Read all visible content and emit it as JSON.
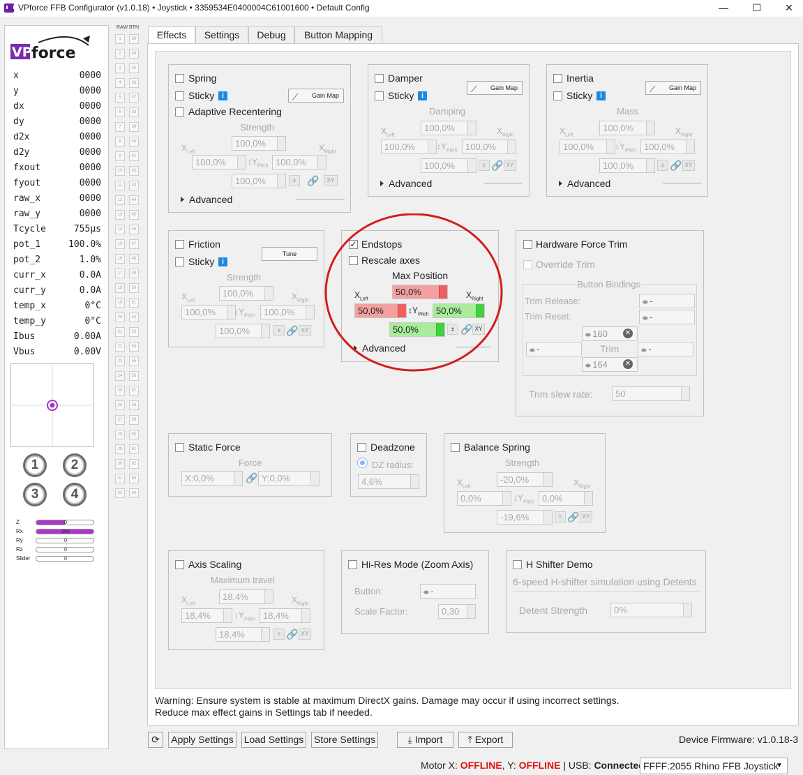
{
  "window": {
    "title": "VPforce FFB Configurator (v1.0.18) • Joystick • 3359534E0400004C61001600 • Default Config",
    "min": "—",
    "max": "☐",
    "close": "✕"
  },
  "telemetry": [
    {
      "k": "x",
      "v": "0000"
    },
    {
      "k": "y",
      "v": "0000"
    },
    {
      "k": "dx",
      "v": "0000"
    },
    {
      "k": "dy",
      "v": "0000"
    },
    {
      "k": "d2x",
      "v": "0000"
    },
    {
      "k": "d2y",
      "v": "0000"
    },
    {
      "k": "fxout",
      "v": "0000"
    },
    {
      "k": "fyout",
      "v": "0000"
    },
    {
      "k": "raw_x",
      "v": "0000"
    },
    {
      "k": "raw_y",
      "v": "0000"
    },
    {
      "k": "Tcycle",
      "v": "755µs"
    },
    {
      "k": "pot_1",
      "v": "100.0%"
    },
    {
      "k": "pot_2",
      "v": "1.0%"
    },
    {
      "k": "curr_x",
      "v": "0.0A"
    },
    {
      "k": "curr_y",
      "v": "0.0A"
    },
    {
      "k": "temp_x",
      "v": "0°C"
    },
    {
      "k": "temp_y",
      "v": "0°C"
    },
    {
      "k": "Ibus",
      "v": "0.00A"
    },
    {
      "k": "Vbus",
      "v": "0.00V"
    }
  ],
  "pov_buttons": [
    "1",
    "2",
    "3",
    "4"
  ],
  "axes": [
    {
      "label": "Z",
      "value": "0",
      "fill": 0.5
    },
    {
      "label": "Rx",
      "value": "255",
      "fill": 1.0
    },
    {
      "label": "Ry",
      "value": "0",
      "fill": 0
    },
    {
      "label": "Rz",
      "value": "0",
      "fill": 0
    },
    {
      "label": "Slider",
      "value": "0",
      "fill": 0
    }
  ],
  "raw_btn": {
    "header": "RAW BTN",
    "left": [
      "1",
      "2",
      "3",
      "4",
      "5",
      "6",
      "7",
      "8",
      "9",
      "10",
      "11",
      "12",
      "13",
      "14",
      "15",
      "16",
      "17",
      "18",
      "19",
      "20",
      "21",
      "22",
      "23",
      "24",
      "25",
      "26",
      "27",
      "28",
      "29",
      "30",
      "31",
      "32"
    ],
    "right": [
      "33",
      "34",
      "35",
      "36",
      "37",
      "38",
      "39",
      "40",
      "41",
      "42",
      "43",
      "44",
      "45",
      "46",
      "47",
      "48",
      "49",
      "50",
      "51",
      "52",
      "53",
      "54",
      "55",
      "56",
      "57",
      "58",
      "59",
      "60",
      "61",
      "62",
      "63",
      "64"
    ]
  },
  "tabs": [
    "Effects",
    "Settings",
    "Debug",
    "Button Mapping"
  ],
  "spring": {
    "title": "Spring",
    "sticky": "Sticky",
    "adaptive": "Adaptive Recentering",
    "gain_map": "Gain Map",
    "strength": "Strength",
    "top": "100,0%",
    "left": "100,0%",
    "right": "100,0%",
    "bottom": "100,0%",
    "advanced": "Advanced"
  },
  "damper": {
    "title": "Damper",
    "sticky": "Sticky",
    "gain_map": "Gain Map",
    "label": "Damping",
    "top": "100,0%",
    "left": "100,0%",
    "right": "100,0%",
    "bottom": "100,0%",
    "advanced": "Advanced"
  },
  "inertia": {
    "title": "Inertia",
    "sticky": "Sticky",
    "gain_map": "Gain Map",
    "label": "Mass",
    "top": "100,0%",
    "left": "100,0%",
    "right": "100,0%",
    "bottom": "100,0%",
    "advanced": "Advanced"
  },
  "friction": {
    "title": "Friction",
    "sticky": "Sticky",
    "tune": "Tune",
    "strength": "Strength",
    "top": "100,0%",
    "left": "100,0%",
    "right": "100,0%",
    "bottom": "100,0%"
  },
  "endstops": {
    "title": "Endstops",
    "rescale": "Rescale axes",
    "max_position": "Max Position",
    "top": "50,0%",
    "left": "50,0%",
    "right": "50,0%",
    "bottom": "50,0%",
    "advanced": "Advanced"
  },
  "trim": {
    "title": "Hardware Force Trim",
    "override": "Override Trim",
    "bindings": "Button Bindings",
    "release": "Trim Release:",
    "reset": "Trim Reset:",
    "release_val": "-",
    "reset_val": "-",
    "b160": "160",
    "b164": "164",
    "left_val": "-",
    "right_val": "-",
    "trim": "Trim",
    "slew_label": "Trim slew rate:",
    "slew": "50"
  },
  "static_force": {
    "title": "Static Force",
    "force": "Force",
    "x": "X:0,0%",
    "y": "Y:0,0%"
  },
  "deadzone": {
    "title": "Deadzone",
    "radius": "DZ radius:",
    "value": "4,6%"
  },
  "balance": {
    "title": "Balance Spring",
    "strength": "Strength",
    "top": "-20,0%",
    "left": "0,0%",
    "right": "0,0%",
    "bottom": "-19,6%"
  },
  "axis_scaling": {
    "title": "Axis Scaling",
    "max": "Maximum travel",
    "top": "18,4%",
    "left": "18,4%",
    "right": "18,4%",
    "bottom": "18,4%"
  },
  "hires": {
    "title": "Hi-Res Mode (Zoom Axis)",
    "button": "Button:",
    "button_val": "-",
    "scale": "Scale Factor:",
    "scale_val": "0,30"
  },
  "hshifter": {
    "title": "H Shifter Demo",
    "desc": "6-speed H-shifter simulation using Detents",
    "detent": "Detent Strength",
    "detent_val": "0%"
  },
  "axis_labels": {
    "xleft": "X",
    "left_sub": "Left",
    "xright": "X",
    "right_sub": "Right",
    "ypitch": "Y",
    "pitch_sub": "Pitch"
  },
  "warning": {
    "bold": "Warning:",
    "line1": " Ensure system is stable at maximum DirectX gains. Damage may occur if using incorrect settings.",
    "line2": "Reduce max effect gains in Settings tab if needed."
  },
  "bottom": {
    "refresh": "⟳",
    "apply": "Apply Settings",
    "load": "Load Settings",
    "store": "Store Settings",
    "import": "Import",
    "export": "Export",
    "firmware": "Device Firmware:  v1.0.18-3"
  },
  "status": {
    "motor": "Motor X: ",
    "x_state": "OFFLINE",
    "y_label": ", Y: ",
    "y_state": "OFFLINE",
    "usb": " | USB: ",
    "usb_state": "Connected",
    "device": "FFFF:2055 Rhino FFB Joystick"
  },
  "colors": {
    "accent": "#a838c8",
    "offline": "#e01010",
    "red_field": "#f4a0a0",
    "green_field": "#a8ec9c",
    "highlight_circle": "#d41c1c"
  }
}
